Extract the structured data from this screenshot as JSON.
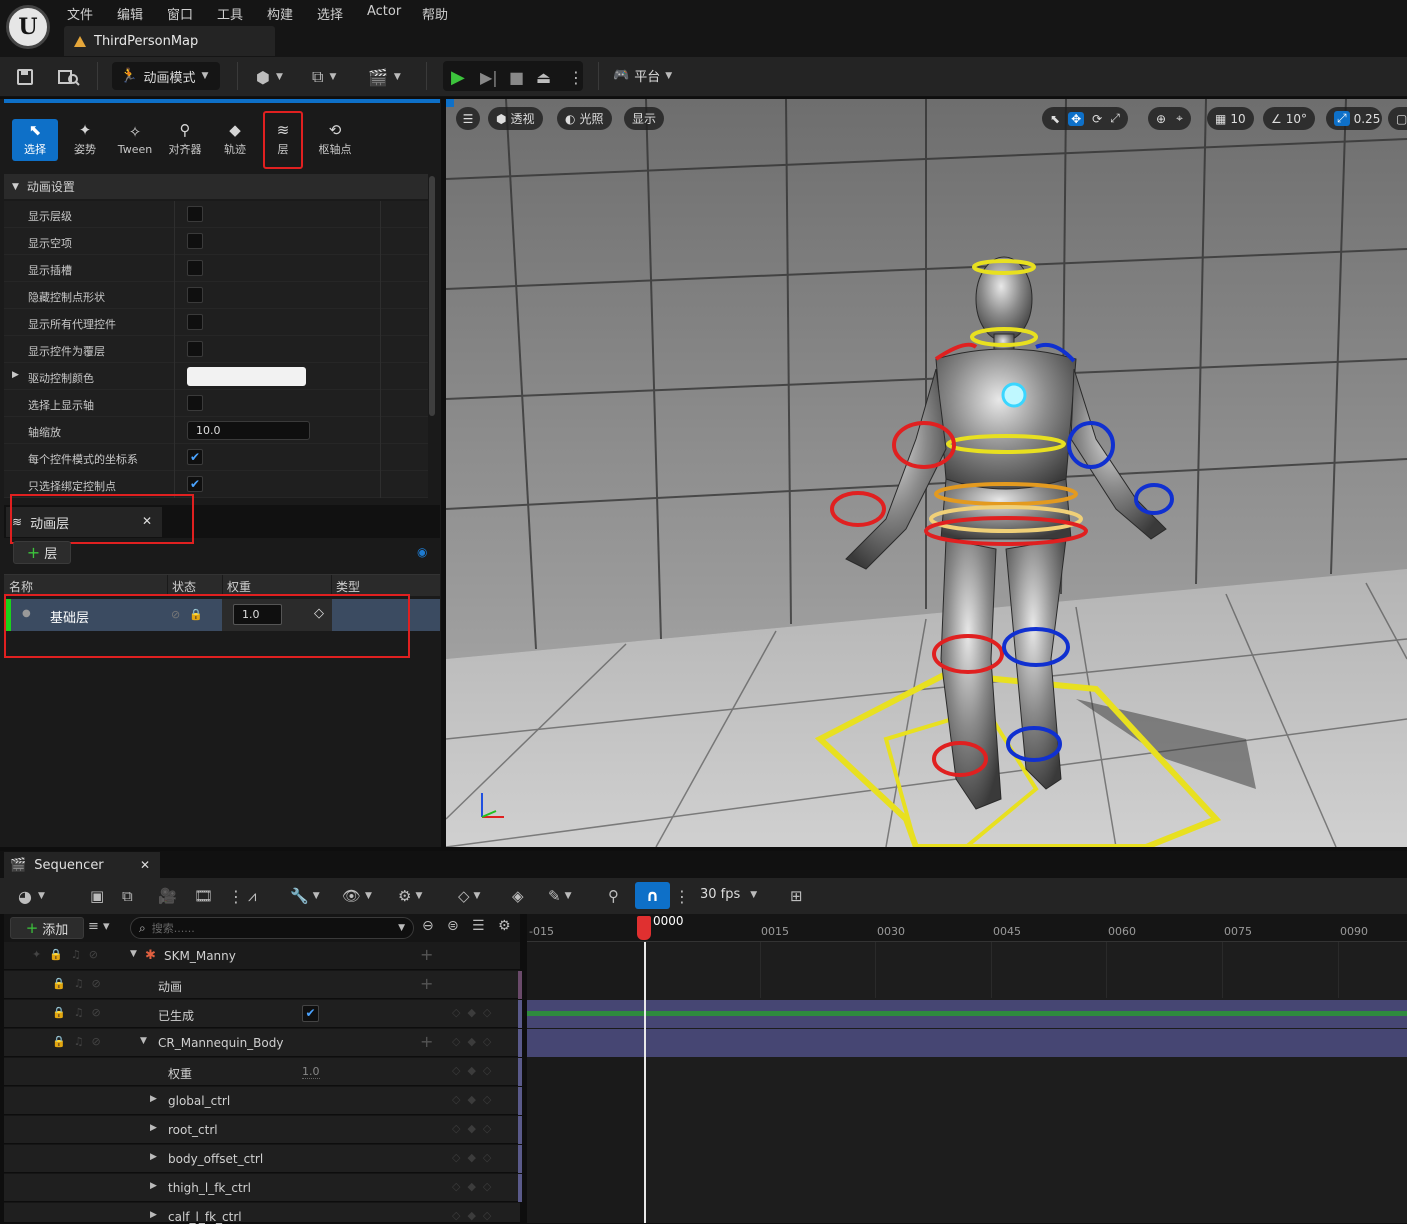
{
  "menubar": {
    "logo_icon": "unreal-logo",
    "items": [
      "文件",
      "编辑",
      "窗口",
      "工具",
      "构建",
      "选择",
      "Actor",
      "帮助"
    ],
    "map_tab": "ThirdPersonMap"
  },
  "toolbar": {
    "mode_label": "动画模式",
    "platform_label": "平台"
  },
  "modes": [
    "选择",
    "姿势",
    "Tween",
    "对齐器",
    "轨迹",
    "层",
    "枢轴点"
  ],
  "anim_settings": {
    "header": "动画设置",
    "rows": [
      {
        "label": "显示层级",
        "checked": false
      },
      {
        "label": "显示空项",
        "checked": false
      },
      {
        "label": "显示插槽",
        "checked": false
      },
      {
        "label": "隐藏控制点形状",
        "checked": false
      },
      {
        "label": "显示所有代理控件",
        "checked": false
      },
      {
        "label": "显示控件为覆层",
        "checked": false
      },
      {
        "label": "驱动控制颜色",
        "color": "#f2f2f2"
      },
      {
        "label": "选择上显示轴",
        "checked": false
      },
      {
        "label": "轴缩放",
        "value": "10.0"
      },
      {
        "label": "每个控件模式的坐标系",
        "checked": true
      },
      {
        "label": "只选择绑定控制点",
        "checked": true
      }
    ]
  },
  "layers": {
    "tab_label": "动画层",
    "add_label": "层",
    "columns": [
      "名称",
      "状态",
      "权重",
      "类型"
    ],
    "rows": [
      {
        "name": "基础层",
        "weight": "1.0"
      }
    ]
  },
  "viewport": {
    "perspective": "透视",
    "lighting": "光照",
    "show": "显示",
    "grid_size": "10",
    "rot_snap": "10°",
    "scale_snap": "0.25"
  },
  "sequencer": {
    "tab_label": "Sequencer",
    "fps": "30 fps",
    "add_label": "添加",
    "search_placeholder": "搜索......",
    "current_frame": "0000",
    "ticks": [
      "-015",
      "0015",
      "0030",
      "0045",
      "0060",
      "0075",
      "0090"
    ],
    "tracks": [
      {
        "name": "SKM_Manny"
      },
      {
        "name": "动画"
      },
      {
        "name": "已生成",
        "checked": true
      },
      {
        "name": "CR_Mannequin_Body"
      },
      {
        "name": "权重",
        "value": "1.0"
      },
      {
        "name": "global_ctrl"
      },
      {
        "name": "root_ctrl"
      },
      {
        "name": "body_offset_ctrl"
      },
      {
        "name": "thigh_l_fk_ctrl"
      },
      {
        "name": "calf_l_fk_ctrl"
      }
    ]
  }
}
